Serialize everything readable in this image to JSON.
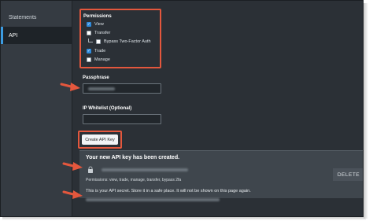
{
  "sidebar": {
    "items": [
      {
        "label": "Statements",
        "active": false
      },
      {
        "label": "API",
        "active": true
      }
    ],
    "accent_color": "#3c9be0"
  },
  "permissions": {
    "heading": "Permissions",
    "options": [
      {
        "label": "View",
        "checked": true
      },
      {
        "label": "Transfer",
        "checked": false
      },
      {
        "label": "Bypass Two-Factor Auth",
        "checked": false
      },
      {
        "label": "Trade",
        "checked": true
      },
      {
        "label": "Manage",
        "checked": false
      }
    ]
  },
  "passphrase": {
    "label": "Passphrase"
  },
  "ip_whitelist": {
    "label": "IP Whitelist (Optional)",
    "value": ""
  },
  "create_button": {
    "label": "Create API Key"
  },
  "new_key_panel": {
    "title": "Your new API key has been created.",
    "permissions_line": "Permissions: view, trade, manage, transfer, bypass 2fa",
    "secret_note": "This is your API secret. Store it in a safe place. It will not be shown on this page again.",
    "delete_label": "DELETE"
  },
  "annotation_color": "#e4573d",
  "icons": [
    "lock-icon",
    "check-icon",
    "arrow-icon"
  ]
}
